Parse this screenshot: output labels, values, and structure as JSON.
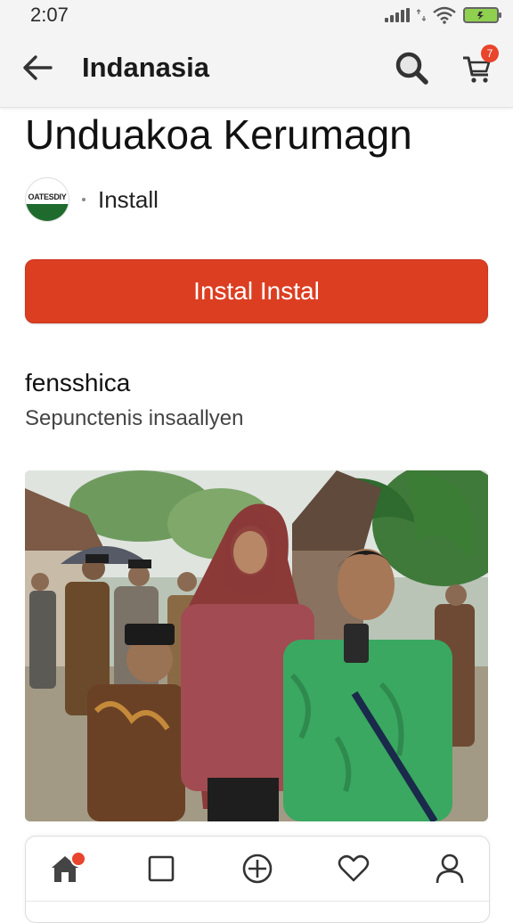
{
  "status_bar": {
    "time": "2:07"
  },
  "app_bar": {
    "title": "Indanasia",
    "cart_badge": "7"
  },
  "page": {
    "title": "Unduakoa Kerumagn",
    "developer_logo_text": "OATESDIY",
    "developer_action": "Install",
    "primary_button": "Instal Instal",
    "section_heading": "fensshica",
    "section_description": "Sepunctenis insaallyen"
  },
  "bottom_nav": {
    "items": [
      {
        "icon": "home-icon",
        "has_badge": true
      },
      {
        "icon": "square-icon"
      },
      {
        "icon": "add-circle-icon"
      },
      {
        "icon": "heart-icon"
      },
      {
        "icon": "profile-icon"
      }
    ]
  },
  "colors": {
    "accent": "#dc3e22",
    "badge": "#e8452c",
    "app_bar_bg": "#f4f4f4",
    "battery": "#8fd14f"
  }
}
